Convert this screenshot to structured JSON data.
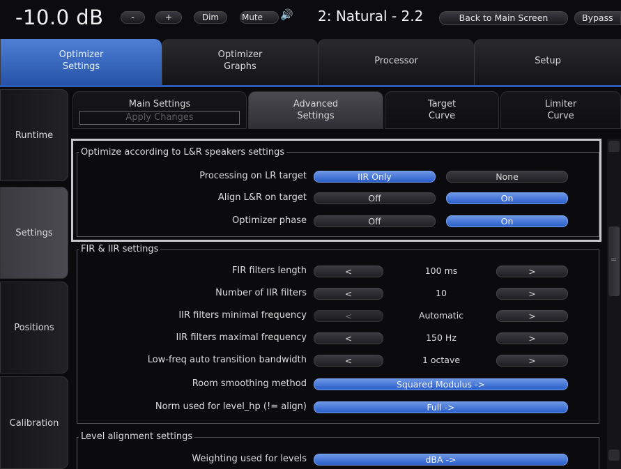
{
  "topbar": {
    "volume": "-10.0 dB",
    "minus_label": "-",
    "plus_label": "+",
    "dim_label": "Dim",
    "mute_label": "Mute",
    "speaker_icon": "🔊",
    "preset": "2: Natural - 2.2",
    "back_label": "Back to Main Screen",
    "bypass_label": "Bypass"
  },
  "top_tabs": [
    {
      "line1": "Optimizer",
      "line2": "Settings"
    },
    {
      "line1": "Optimizer",
      "line2": "Graphs"
    },
    {
      "line1": "Processor",
      "line2": ""
    },
    {
      "line1": "Setup",
      "line2": ""
    }
  ],
  "side_tabs": [
    "Runtime",
    "Settings",
    "Positions",
    "Calibration"
  ],
  "sub_tabs": [
    {
      "line1": "Main Settings",
      "line2": "Apply Changes"
    },
    {
      "line1": "Advanced",
      "line2": "Settings"
    },
    {
      "line1": "Target",
      "line2": "Curve"
    },
    {
      "line1": "Limiter",
      "line2": "Curve"
    }
  ],
  "lr_group": {
    "title": "Optimize according to L&R speakers settings",
    "rows": [
      {
        "label": "Processing on LR target",
        "opt1": "IIR Only",
        "opt2": "None"
      },
      {
        "label": "Align L&R on target",
        "opt1": "Off",
        "opt2": "On"
      },
      {
        "label": "Optimizer phase",
        "opt1": "Off",
        "opt2": "On"
      }
    ]
  },
  "fir_group": {
    "title": "FIR & IIR settings",
    "rows": [
      {
        "label": "FIR filters length",
        "dec": "<",
        "value": "100 ms",
        "inc": ">"
      },
      {
        "label": "Number of IIR filters",
        "dec": "<",
        "value": "10",
        "inc": ">"
      },
      {
        "label": "IIR filters minimal frequency",
        "dec": "<",
        "value": "Automatic",
        "inc": ">"
      },
      {
        "label": "IIR filters maximal frequency",
        "dec": "<",
        "value": "150 Hz",
        "inc": ">"
      },
      {
        "label": "Low-freq auto transition bandwidth",
        "dec": "<",
        "value": "1 octave",
        "inc": ">"
      },
      {
        "label": "Room smoothing method",
        "value": "Squared Modulus ->"
      },
      {
        "label": "Norm used for level_hp (!= align)",
        "value": "Full ->"
      }
    ]
  },
  "level_group": {
    "title": "Level alignment settings",
    "rows": [
      {
        "label": "Weighting used for levels",
        "value": "dBA ->"
      }
    ]
  },
  "scroll_mark": "=",
  "colors": {
    "accent_blue": "#2a5ec9",
    "highlight_border": "#c8c8cc"
  }
}
